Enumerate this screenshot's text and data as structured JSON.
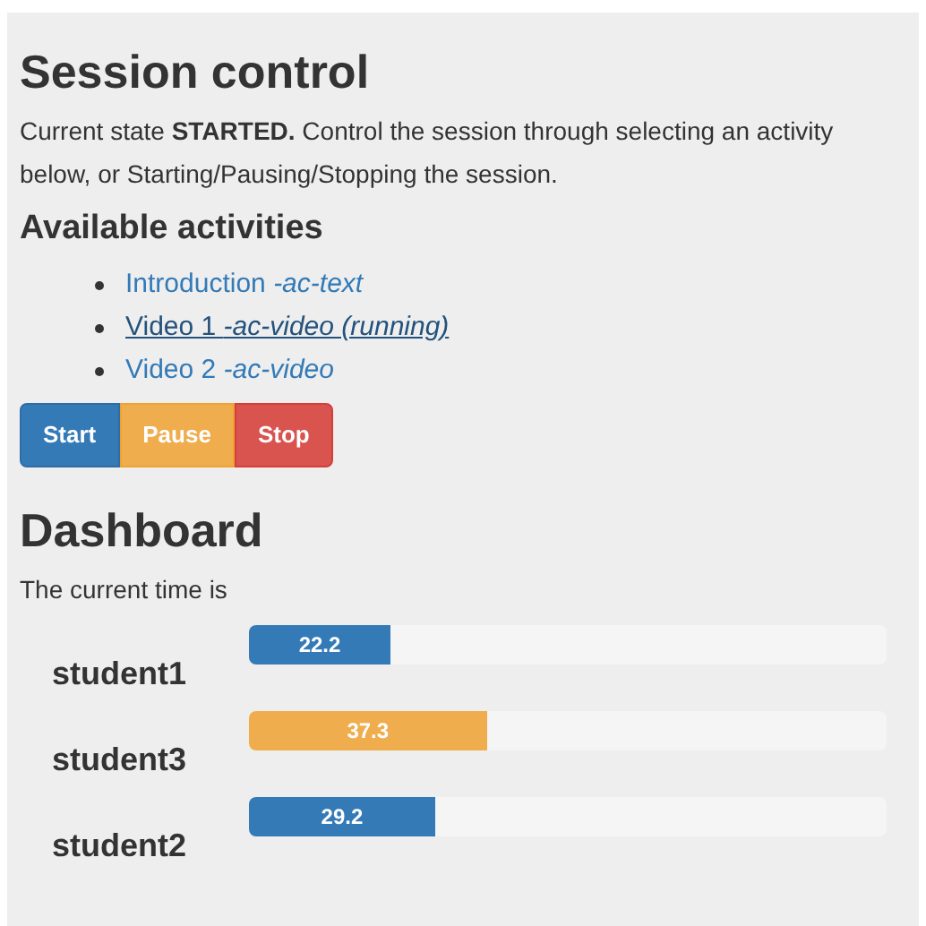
{
  "session": {
    "title": "Session control",
    "description": "Current state **STARTED.** Control the session through selecting an activity below, or Starting/Pausing/Stopping the session.",
    "activities_title": "Available activities",
    "activities": [
      {
        "name": "Introduction",
        "type": "-ac-text",
        "selected": false
      },
      {
        "name": "Video 1",
        "type": "-ac-video (running)",
        "selected": true
      },
      {
        "name": "Video 2",
        "type": "-ac-video",
        "selected": false
      }
    ],
    "buttons": [
      {
        "label": "Start",
        "kind": "primary"
      },
      {
        "label": "Pause",
        "kind": "warning"
      },
      {
        "label": "Stop",
        "kind": "danger"
      }
    ]
  },
  "dashboard": {
    "title": "Dashboard",
    "time_text": "The current time is",
    "students": [
      {
        "name": "student1",
        "value": "22.2",
        "level": 0.222,
        "color": "#337ab7"
      },
      {
        "name": "student3",
        "value": "37.3",
        "level": 0.373,
        "color": "#f0ad4e"
      },
      {
        "name": "student2",
        "value": "29.2",
        "level": 0.292,
        "color": "#337ab7"
      }
    ]
  }
}
